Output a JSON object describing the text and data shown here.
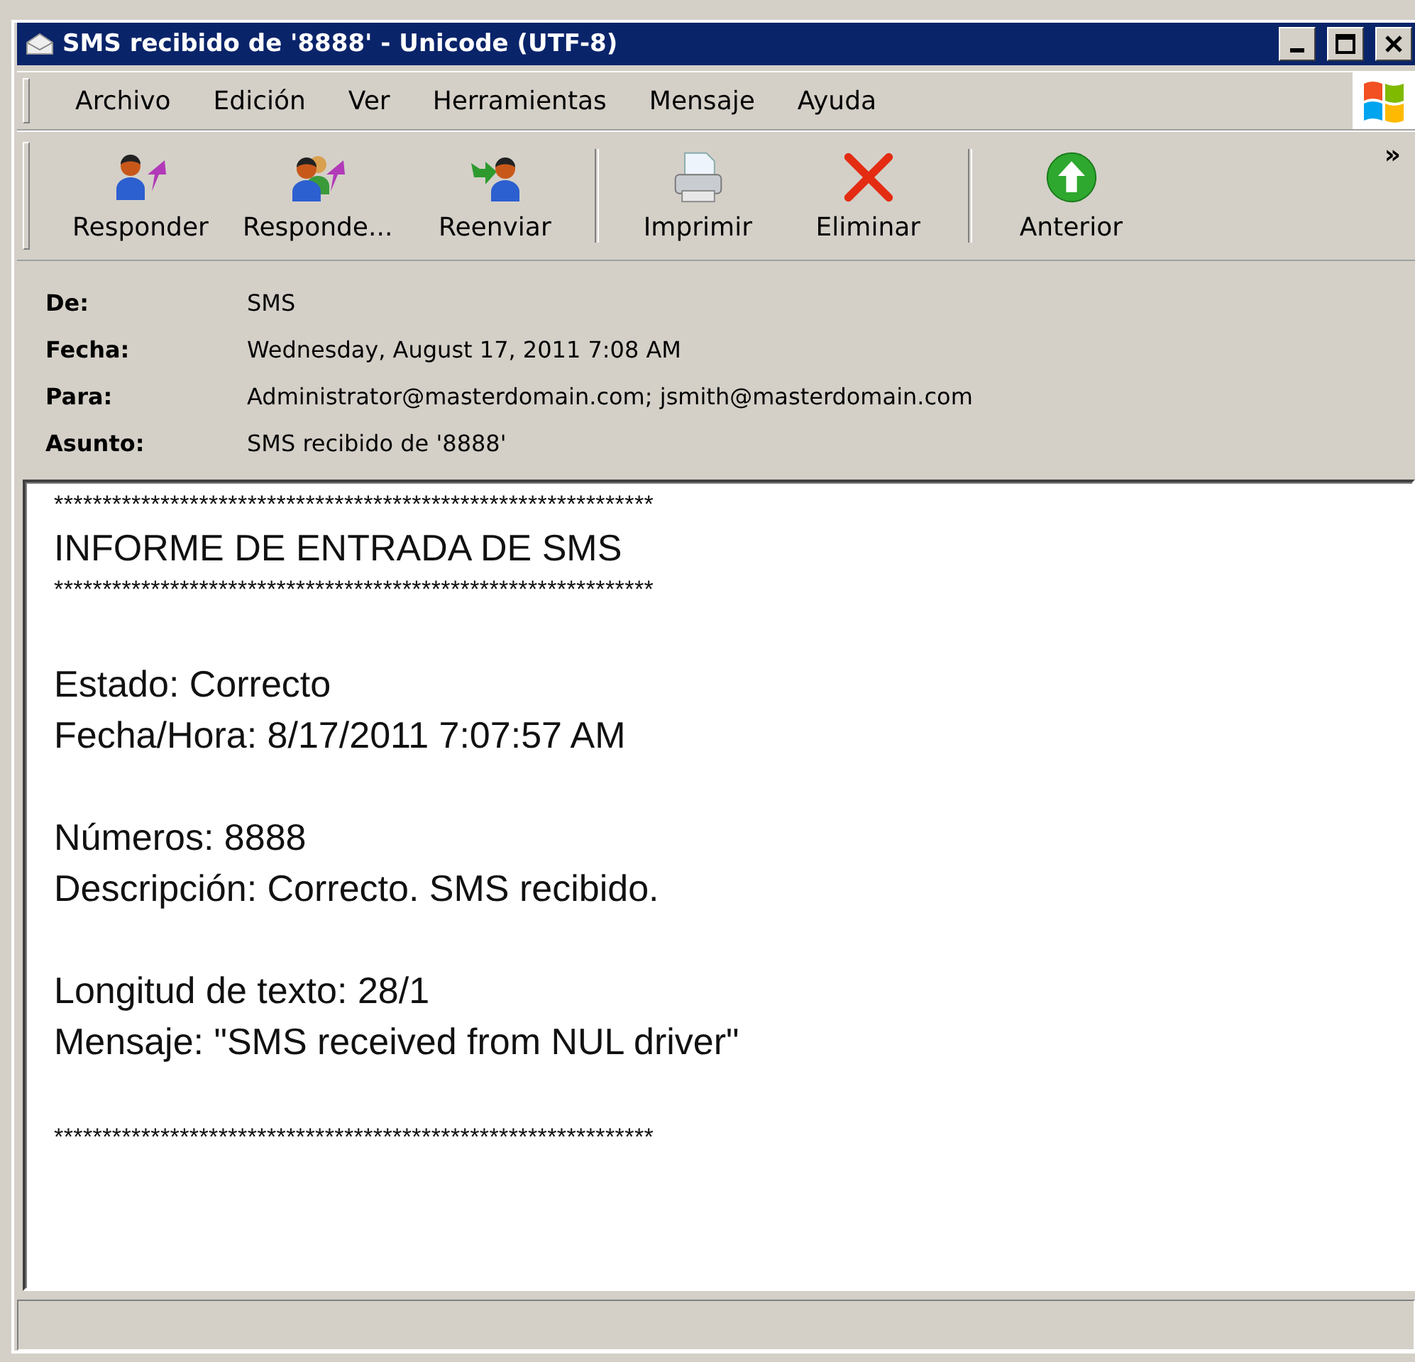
{
  "window": {
    "title": "SMS recibido de '8888' - Unicode (UTF-8)"
  },
  "menu": [
    {
      "label": "Archivo"
    },
    {
      "label": "Edición"
    },
    {
      "label": "Ver"
    },
    {
      "label": "Herramientas"
    },
    {
      "label": "Mensaje"
    },
    {
      "label": "Ayuda"
    }
  ],
  "toolbar": [
    {
      "kind": "reply",
      "label": "Responder"
    },
    {
      "kind": "replyall",
      "label": "Responde..."
    },
    {
      "kind": "forward",
      "label": "Reenviar"
    },
    {
      "kind": "separator"
    },
    {
      "kind": "print",
      "label": "Imprimir"
    },
    {
      "kind": "delete",
      "label": "Eliminar"
    },
    {
      "kind": "separator"
    },
    {
      "kind": "previous",
      "label": "Anterior"
    }
  ],
  "toolbar_overflow": "»",
  "header": [
    {
      "label": "De:",
      "value": "SMS"
    },
    {
      "label": "Fecha:",
      "value": "Wednesday, August 17, 2011 7:08 AM"
    },
    {
      "label": "Para:",
      "value": "Administrator@masterdomain.com; jsmith@masterdomain.com"
    },
    {
      "label": "Asunto:",
      "value": "SMS recibido de '8888'"
    }
  ],
  "body": {
    "banner": [
      "**************************************************************",
      "INFORME DE ENTRADA DE SMS",
      "**************************************************************"
    ],
    "sections": [
      [
        "Estado: Correcto",
        "Fecha/Hora: 8/17/2011 7:07:57 AM"
      ],
      [
        "Números: 8888",
        "Descripción: Correcto. SMS recibido."
      ],
      [
        "Longitud de texto: 28/1",
        "Mensaje: \"SMS received from NUL driver\""
      ]
    ],
    "footer": "**************************************************************"
  }
}
